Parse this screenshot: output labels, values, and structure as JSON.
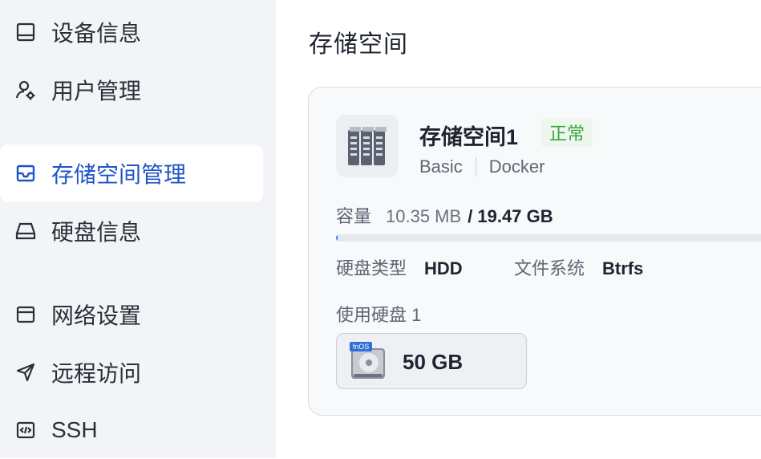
{
  "sidebar": {
    "items": [
      {
        "label": "设备信息",
        "icon": "monitor-icon"
      },
      {
        "label": "用户管理",
        "icon": "user-settings-icon"
      },
      {
        "label": "存储空间管理",
        "icon": "inbox-icon",
        "active": true
      },
      {
        "label": "硬盘信息",
        "icon": "hard-drive-icon"
      },
      {
        "label": "网络设置",
        "icon": "network-icon"
      },
      {
        "label": "远程访问",
        "icon": "send-icon"
      },
      {
        "label": "SSH",
        "icon": "code-icon"
      }
    ]
  },
  "main": {
    "title": "存储空间",
    "volume": {
      "name": "存储空间1",
      "status": "正常",
      "raid": "Basic",
      "usage": "Docker",
      "capacity_label": "容量",
      "used": "10.35 MB",
      "total": "/ 19.47 GB",
      "progress_percent": 0.05,
      "disk_type_label": "硬盘类型",
      "disk_type": "HDD",
      "fs_label": "文件系统",
      "fs": "Btrfs",
      "used_disks_label": "使用硬盘 1",
      "disk": {
        "badge": "fnOS",
        "size": "50 GB"
      }
    }
  },
  "colors": {
    "accent": "#1f54c4",
    "status_green": "#38a53d",
    "status_bg": "#eef7ee",
    "progress": "#3a7bea"
  }
}
